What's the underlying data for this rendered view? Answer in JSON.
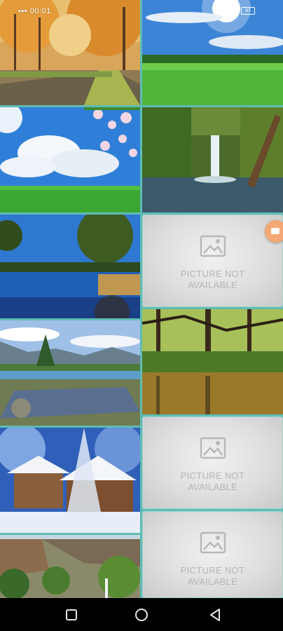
{
  "status_bar": {
    "time": "00:01",
    "battery": "87"
  },
  "wallpapers": {
    "left": [
      {
        "name": "autumn-road"
      },
      {
        "name": "sky-blossom-meadow"
      },
      {
        "name": "lake-sunset"
      },
      {
        "name": "mountain-stream"
      },
      {
        "name": "snow-cabin"
      },
      {
        "name": "canyon-forest"
      }
    ],
    "right": [
      {
        "name": "green-field-sun"
      },
      {
        "name": "waterfall"
      },
      {
        "name": "unavailable"
      },
      {
        "name": "forest-swamp"
      },
      {
        "name": "unavailable"
      },
      {
        "name": "unavailable"
      }
    ]
  },
  "placeholder": {
    "line1": "PICTURE NOT",
    "line2": "AVAILABLE",
    "icon": "broken-image-icon"
  },
  "navigation": {
    "recent_icon": "square-icon",
    "home_icon": "circle-icon",
    "back_icon": "triangle-back-icon"
  },
  "colors": {
    "background": "#5fbcb4",
    "fab": "#f3a875"
  }
}
